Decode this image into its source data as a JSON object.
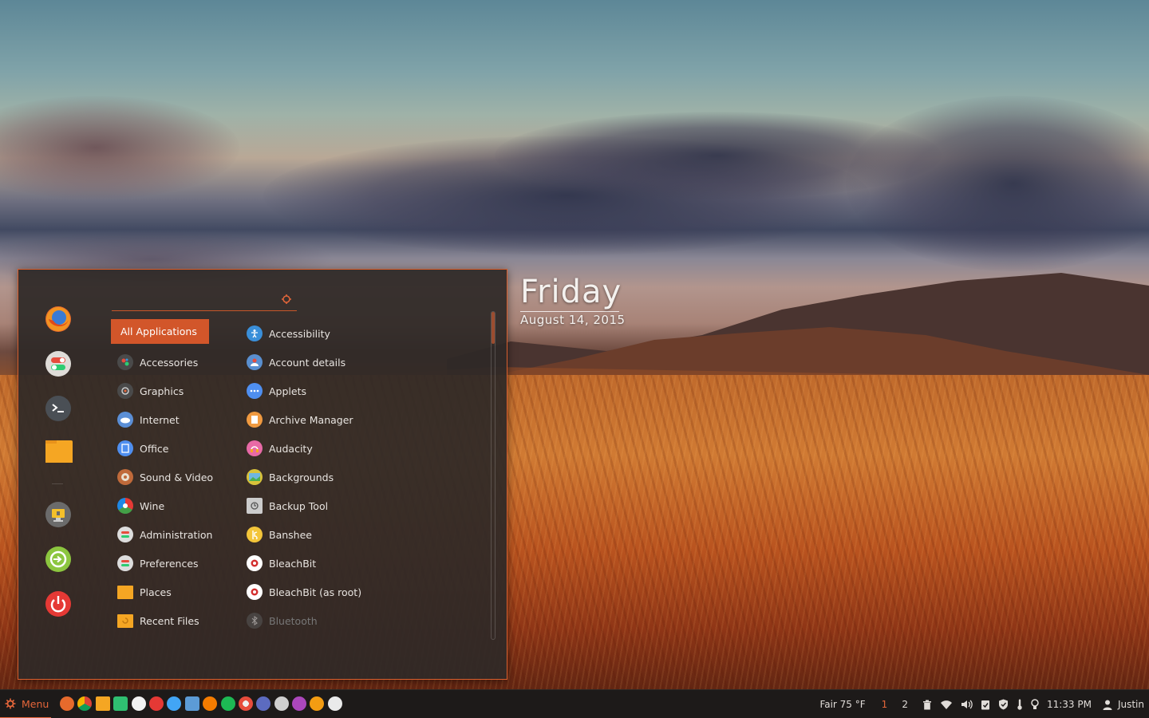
{
  "desklet": {
    "day": "Friday",
    "date": "August 14, 2015"
  },
  "menu": {
    "search": {
      "value": "",
      "placeholder": ""
    },
    "favorites": [
      {
        "name": "firefox",
        "color": "#e66a2c"
      },
      {
        "name": "settings-toggle",
        "color": "#dfdcd8"
      },
      {
        "name": "terminal",
        "color": "#4a4f55"
      },
      {
        "name": "files-folder",
        "color": "#f5a623"
      },
      {
        "name": "lock-screen",
        "color": "#6b6b6b"
      },
      {
        "name": "logout",
        "color": "#8cc63f"
      },
      {
        "name": "shutdown",
        "color": "#e53935"
      }
    ],
    "categories": [
      {
        "label": "All Applications",
        "icon": "none",
        "color": "#d2562a"
      },
      {
        "label": "Accessories",
        "icon": "accessories-icon",
        "color": "#4a4a4a"
      },
      {
        "label": "Graphics",
        "icon": "graphics-icon",
        "color": "#4a4a4a"
      },
      {
        "label": "Internet",
        "icon": "internet-icon",
        "color": "#5b8fd6"
      },
      {
        "label": "Office",
        "icon": "office-icon",
        "color": "#4f8ff0"
      },
      {
        "label": "Sound & Video",
        "icon": "sound-video-icon",
        "color": "#c06a3a"
      },
      {
        "label": "Wine",
        "icon": "wine-icon",
        "color": "#e94c3c"
      },
      {
        "label": "Administration",
        "icon": "administration-icon",
        "color": "#dddddd"
      },
      {
        "label": "Preferences",
        "icon": "preferences-icon",
        "color": "#dddddd"
      },
      {
        "label": "Places",
        "icon": "folder-icon",
        "color": "#f5a623"
      },
      {
        "label": "Recent Files",
        "icon": "recent-folder-icon",
        "color": "#f5a623"
      }
    ],
    "apps": [
      {
        "label": "Accessibility",
        "icon": "accessibility-icon",
        "color": "#3a8fd9"
      },
      {
        "label": "Account details",
        "icon": "account-icon",
        "color": "#5a8fcf"
      },
      {
        "label": "Applets",
        "icon": "applets-icon",
        "color": "#4f8ff0"
      },
      {
        "label": "Archive Manager",
        "icon": "archive-icon",
        "color": "#f09a40"
      },
      {
        "label": "Audacity",
        "icon": "audacity-icon",
        "color": "#e86aa6"
      },
      {
        "label": "Backgrounds",
        "icon": "backgrounds-icon",
        "color": "#d8c23a"
      },
      {
        "label": "Backup Tool",
        "icon": "backup-icon",
        "color": "#cccccc"
      },
      {
        "label": "Banshee",
        "icon": "banshee-icon",
        "color": "#f3c53a"
      },
      {
        "label": "BleachBit",
        "icon": "bleachbit-icon",
        "color": "#ffffff"
      },
      {
        "label": "BleachBit (as root)",
        "icon": "bleachbit-root-icon",
        "color": "#ffffff"
      },
      {
        "label": "Bluetooth",
        "icon": "bluetooth-icon",
        "color": "#555555"
      }
    ]
  },
  "panel": {
    "menu_label": "Menu",
    "launchers": [
      {
        "name": "firefox",
        "color": "#e66a2c"
      },
      {
        "name": "chrome",
        "color": "#4caf50"
      },
      {
        "name": "files",
        "color": "#f5a623"
      },
      {
        "name": "system-monitor",
        "color": "#2fbf71"
      },
      {
        "name": "media-player",
        "color": "#f2f2f2"
      },
      {
        "name": "software-manager",
        "color": "#e53935"
      },
      {
        "name": "network",
        "color": "#42a5f5"
      },
      {
        "name": "text-editor",
        "color": "#5c9bd6"
      },
      {
        "name": "game",
        "color": "#f57c00"
      },
      {
        "name": "spotify",
        "color": "#1db954"
      },
      {
        "name": "screenshot",
        "color": "#e74c3c"
      },
      {
        "name": "pen-tool",
        "color": "#5c6bc0"
      },
      {
        "name": "guitar",
        "color": "#cfcfcf"
      },
      {
        "name": "headphones",
        "color": "#ab47bc"
      },
      {
        "name": "vlc",
        "color": "#f39c12"
      },
      {
        "name": "mail",
        "color": "#eaeaea"
      }
    ],
    "weather": "Fair 75 °F",
    "workspaces": [
      "1",
      "2"
    ],
    "clock": "11:33 PM",
    "user": "Justin"
  }
}
